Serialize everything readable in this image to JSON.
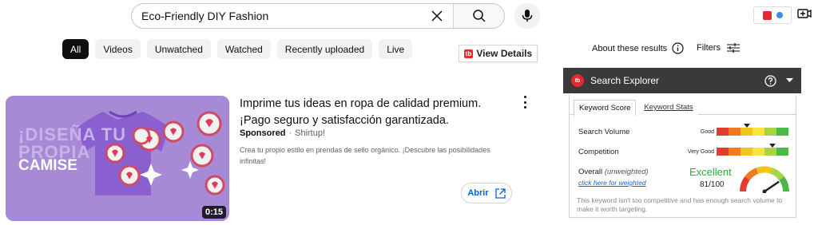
{
  "search": {
    "value": "Eco-Friendly DIY Fashion"
  },
  "chips": [
    {
      "label": "All",
      "active": true
    },
    {
      "label": "Videos",
      "active": false
    },
    {
      "label": "Unwatched",
      "active": false
    },
    {
      "label": "Watched",
      "active": false
    },
    {
      "label": "Recently uploaded",
      "active": false
    },
    {
      "label": "Live",
      "active": false
    }
  ],
  "view_details": {
    "badge": "tb",
    "label": "View Details"
  },
  "about": {
    "label": "About these results"
  },
  "filters": {
    "label": "Filters"
  },
  "ad": {
    "thumbnail_text": [
      "¡DISEÑA TU",
      "PROPIA",
      "CAMISE"
    ],
    "duration": "0:15",
    "title": "Imprime tus ideas en ropa de calidad premium. ¡Pago seguro y satisfacción garantizada.",
    "sponsored": "Sponsored",
    "separator": "·",
    "advertiser": "Shirtup!",
    "description": "Crea tu propio estilo en prendas de sello orgánico. ¡Descubre las posibilidades infinitas!",
    "open_label": "Abrir"
  },
  "search_explorer": {
    "logo": "tb",
    "title": "Search Explorer",
    "tabs": [
      "Keyword Score",
      "Keyword Stats"
    ],
    "rows": [
      {
        "label": "Search Volume",
        "rating": "Good",
        "level": 0.42
      },
      {
        "label": "Competition",
        "rating": "Very Good",
        "level": 0.78
      }
    ],
    "overall_label": "Overall",
    "overall_note": "(unweighted)",
    "weighted_link": "click here for weighted",
    "verdict": "Excellent",
    "score": "81/100",
    "gauge_level": 0.81,
    "footnote": "This keyword isn't too competitive and has enough search volume to make it worth targeting.",
    "meter_colors": [
      "#e33b2e",
      "#f07a24",
      "#f0c419",
      "#f6e63a",
      "#a7d444",
      "#4cb848"
    ]
  }
}
